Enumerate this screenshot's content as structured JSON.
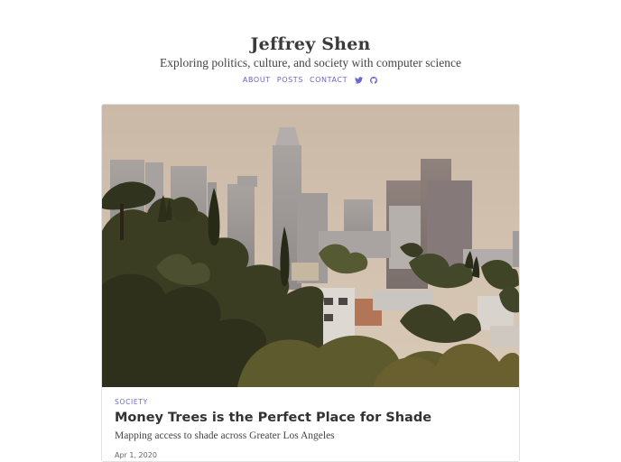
{
  "site": {
    "title": "Jeffrey Shen",
    "tagline": "Exploring politics, culture, and society with computer science"
  },
  "nav": {
    "items": [
      {
        "label": "ABOUT"
      },
      {
        "label": "POSTS"
      },
      {
        "label": "CONTACT"
      }
    ],
    "icons": [
      "twitter-icon",
      "github-icon"
    ]
  },
  "post": {
    "category": "SOCIETY",
    "title": "Money Trees is the Perfect Place for Shade",
    "subtitle": "Mapping access to shade across Greater Los Angeles",
    "date": "Apr 1, 2020",
    "image": "Los Angeles skyline above tree-covered hillside homes"
  },
  "colors": {
    "accent": "#6b66c9",
    "text": "#333333",
    "border": "#e3e3e3"
  }
}
